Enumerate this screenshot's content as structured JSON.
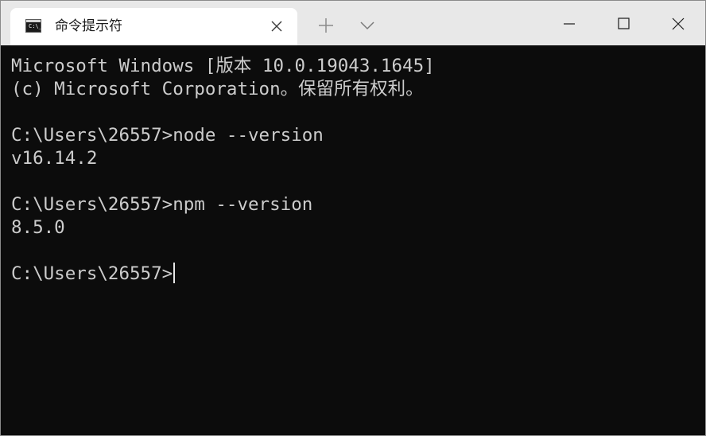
{
  "window": {
    "tab": {
      "title": "命令提示符",
      "icon": "command-prompt-icon",
      "icon_glyph": "C:\\_"
    },
    "controls": {
      "new_tab_icon": "plus-icon",
      "dropdown_icon": "chevron-down-icon",
      "minimize_icon": "minimize-icon",
      "maximize_icon": "maximize-icon",
      "close_icon": "close-icon"
    }
  },
  "terminal": {
    "lines": [
      "Microsoft Windows [版本 10.0.19043.1645]",
      "(c) Microsoft Corporation。保留所有权利。",
      "",
      "C:\\Users\\26557>node --version",
      "v16.14.2",
      "",
      "C:\\Users\\26557>npm --version",
      "8.5.0",
      "",
      "C:\\Users\\26557>"
    ],
    "colors": {
      "background": "#0c0c0c",
      "foreground": "#cccccc"
    }
  }
}
